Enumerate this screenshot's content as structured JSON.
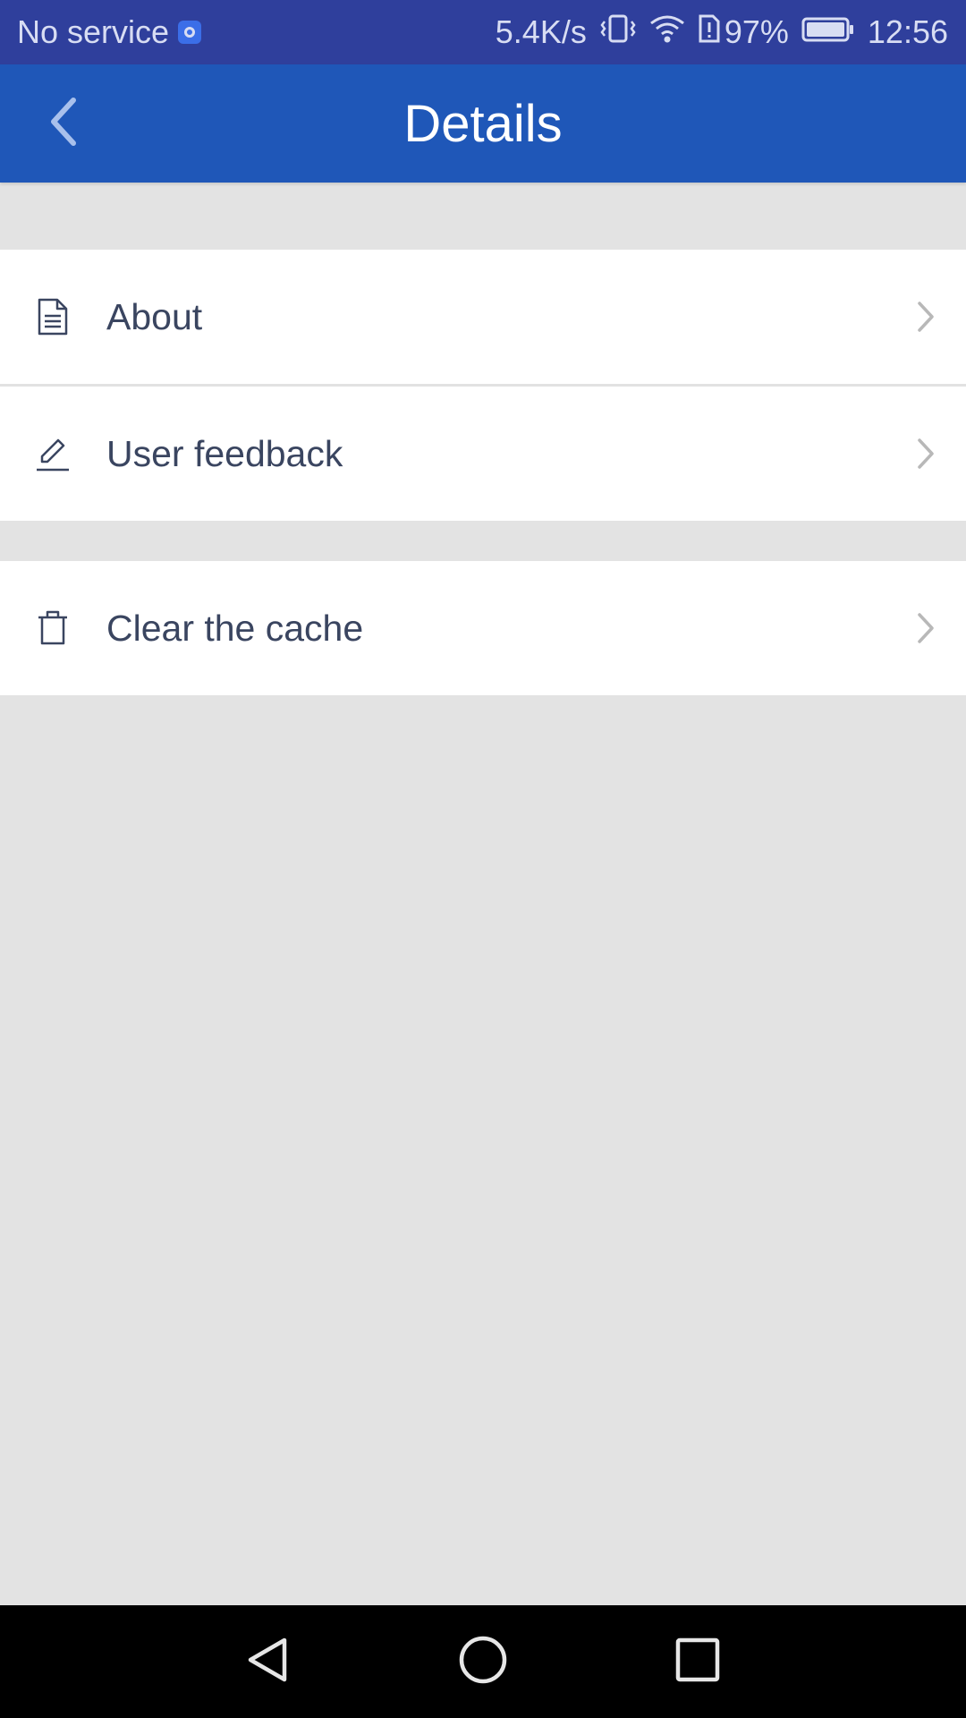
{
  "status_bar": {
    "carrier": "No service",
    "speed": "5.4K/s",
    "battery": "97%",
    "time": "12:56",
    "icons": [
      "app-notification-icon",
      "vibrate-icon",
      "wifi-icon",
      "sim-alert-icon",
      "battery-icon"
    ]
  },
  "header": {
    "title": "Details",
    "back_icon": "chevron-left-icon"
  },
  "menu": {
    "items": [
      {
        "label": "About",
        "icon": "document-icon"
      },
      {
        "label": "User feedback",
        "icon": "pencil-icon"
      },
      {
        "label": "Clear the cache",
        "icon": "trash-icon"
      }
    ]
  },
  "nav_bar": {
    "buttons": [
      "back-triangle-icon",
      "home-circle-icon",
      "recents-square-icon"
    ]
  },
  "colors": {
    "status_bar": "#2f3f9c",
    "header": "#1f57b8",
    "background": "#e3e3e3",
    "row_text": "#3a4560"
  }
}
